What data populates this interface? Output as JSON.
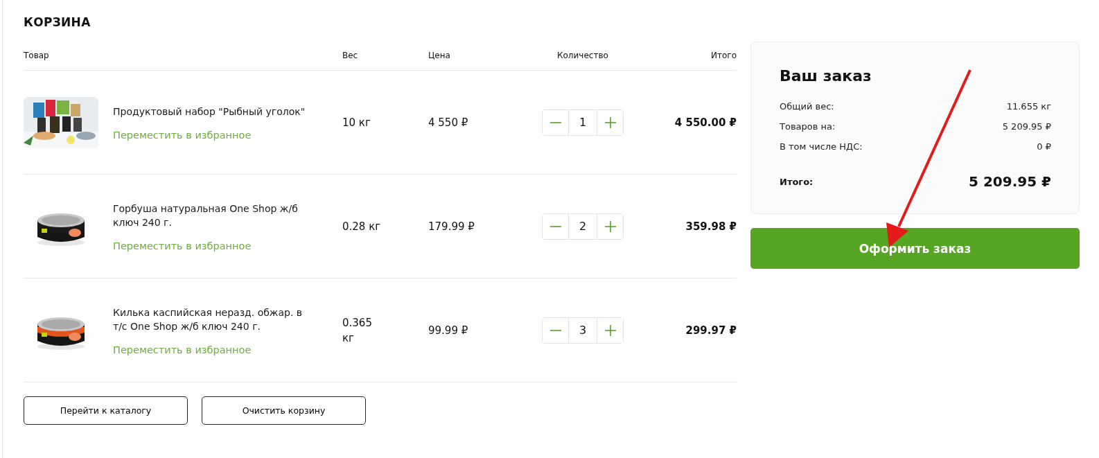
{
  "title": "КОРЗИНА",
  "columns": [
    "Товар",
    "Вес",
    "Цена",
    "Количество",
    "Итого"
  ],
  "items": [
    {
      "name": "Продуктовый набор \"Рыбный уголок\"",
      "favorite_link": "Переместить в избранное",
      "weight": "10 кг",
      "price": "4 550 ₽",
      "quantity": "1",
      "total": "4 550.00 ₽"
    },
    {
      "name": "Горбуша натуральная One Shop ж/б ключ 240 г.",
      "favorite_link": "Переместить в избранное",
      "weight": "0.28 кг",
      "price": "179.99 ₽",
      "quantity": "2",
      "total": "359.98 ₽"
    },
    {
      "name": "Килька каспийская неразд. обжар. в т/с One Shop ж/б ключ 240 г.",
      "favorite_link": "Переместить в избранное",
      "weight": "0.365 кг",
      "price": "99.99 ₽",
      "quantity": "3",
      "total": "299.97 ₽"
    }
  ],
  "actions": [
    "Перейти к каталогу",
    "Очистить корзину"
  ],
  "summary": {
    "title": "Ваш заказ",
    "lines": [
      {
        "label": "Общий вес:",
        "value": "11.655 кг"
      },
      {
        "label": "Товаров на:",
        "value": "5 209.95 ₽"
      },
      {
        "label": "В том числе НДС:",
        "value": "0 ₽"
      }
    ],
    "total_label": "Итого:",
    "total_value": "5 209.95 ₽",
    "checkout": "Оформить заказ"
  }
}
